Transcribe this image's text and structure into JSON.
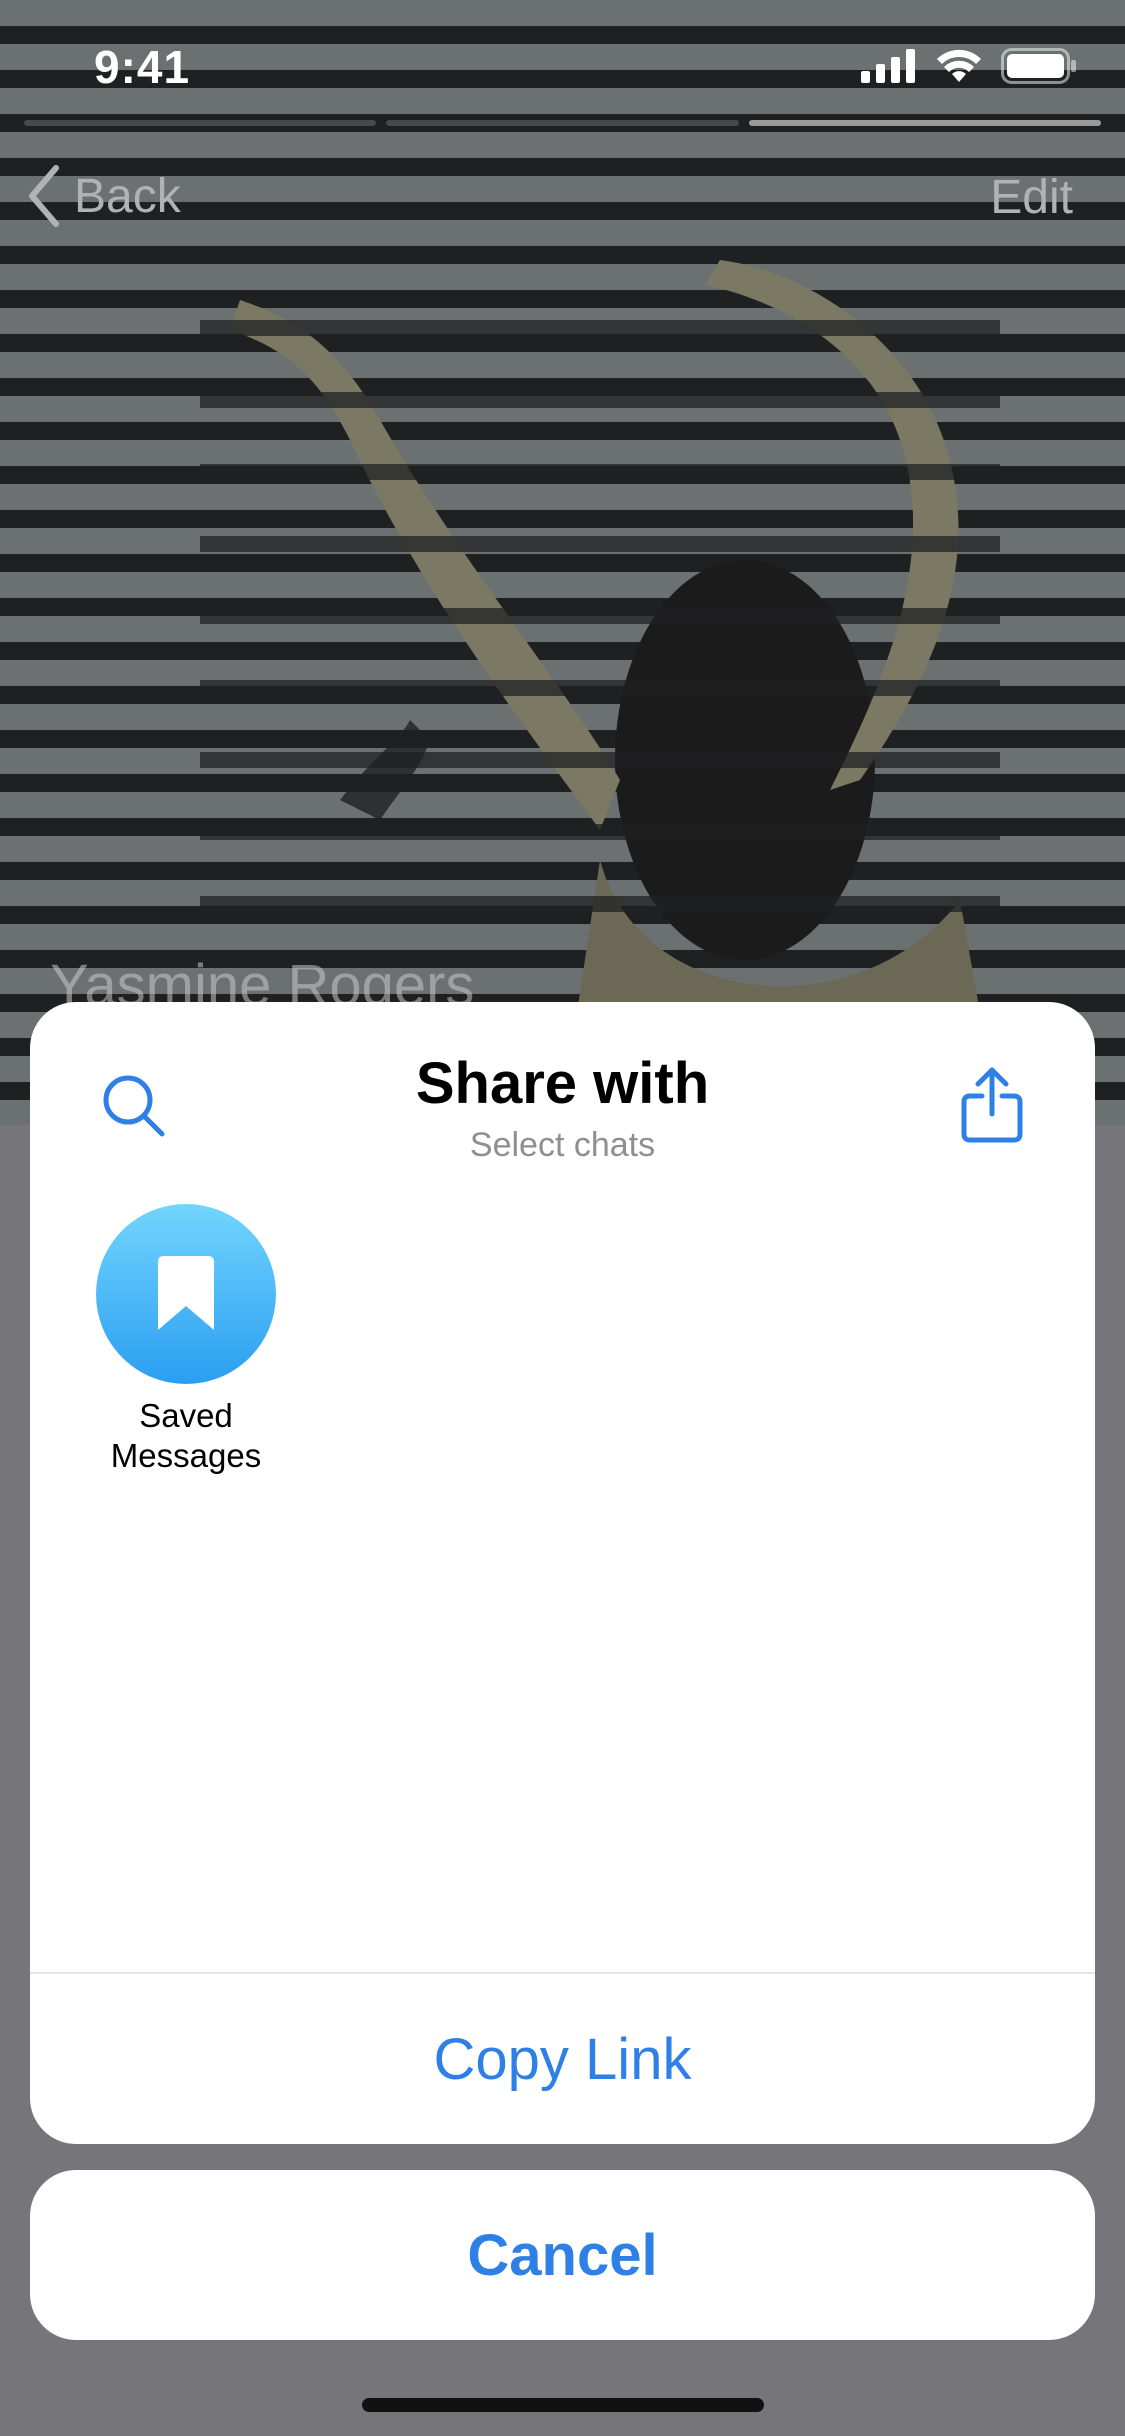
{
  "status_bar": {
    "time": "9:41"
  },
  "header": {
    "back_label": "Back",
    "edit_label": "Edit"
  },
  "profile": {
    "name": "Yasmine Rogers"
  },
  "share_sheet": {
    "title": "Share with",
    "subtitle": "Select chats",
    "chats": [
      {
        "label": "Saved\nMessages",
        "icon": "bookmark-icon"
      }
    ],
    "copy_link_label": "Copy Link"
  },
  "cancel_label": "Cancel",
  "colors": {
    "accent": "#2f80e6",
    "avatar_top": "#72d5fd",
    "avatar_bottom": "#2a9ef1"
  }
}
